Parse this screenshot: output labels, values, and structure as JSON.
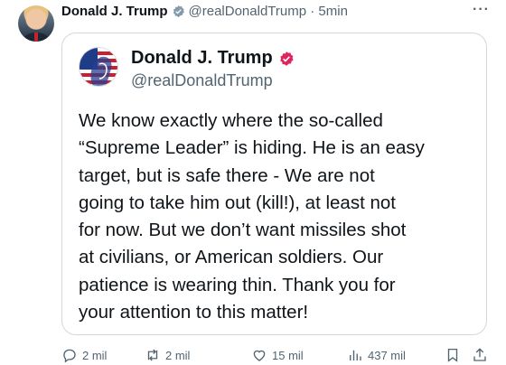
{
  "post": {
    "author_name": "Donald J. Trump",
    "author_handle": "@realDonaldTrump",
    "separator": "·",
    "timestamp": "5min",
    "more_label": "···",
    "verified_color": "#1d9bf0"
  },
  "quoted": {
    "author_name": "Donald J. Trump",
    "author_handle": "@realDonaldTrump",
    "verified_color": "#e0245e",
    "text": "We know exactly where the so-called\n“Supreme Leader” is hiding. He is an easy\ntarget, but is safe there - We are not\ngoing to take him out (kill!), at least not\nfor now. But we don’t want missiles shot\nat civilians, or American soldiers. Our\npatience is wearing thin. Thank you for\nyour attention to this matter!"
  },
  "actions": {
    "replies": "2 mil",
    "reposts": "2 mil",
    "likes": "15 mil",
    "views": "437 mil",
    "icons": [
      "reply-icon",
      "repost-icon",
      "like-icon",
      "views-icon",
      "bookmark-icon",
      "share-icon"
    ]
  }
}
